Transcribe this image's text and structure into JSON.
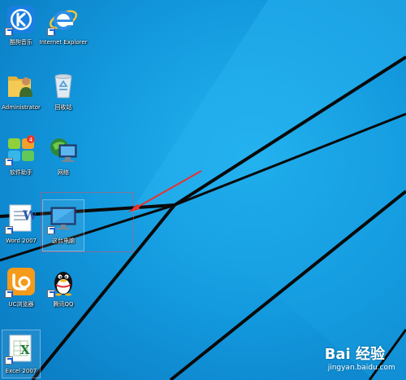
{
  "desktop": {
    "background_color": "#1196dd",
    "line_color": "#0b0b0b",
    "icons": [
      {
        "label": "酷狗音乐",
        "icon": "kugou-k-icon"
      },
      {
        "label": "Internet Explorer",
        "icon": "internet-explorer-icon"
      },
      {
        "label": "Administrator",
        "icon": "user-folder-icon"
      },
      {
        "label": "回收站",
        "icon": "recycle-bin-icon"
      },
      {
        "label": "软件助手",
        "icon": "software-assistant-icon",
        "badge": "4"
      },
      {
        "label": "网络",
        "icon": "network-globe-icon"
      },
      {
        "label": "Word 2007",
        "icon": "word-document-icon"
      },
      {
        "label": "这台电脑",
        "icon": "this-pc-icon"
      },
      {
        "label": "UC浏览器",
        "icon": "uc-browser-icon"
      },
      {
        "label": "腾讯QQ",
        "icon": "qq-penguin-icon"
      },
      {
        "label": "Excel 2007",
        "icon": "excel-spreadsheet-icon"
      }
    ]
  },
  "watermark": {
    "brand": "Bai 经验",
    "url": "jingyan.baidu.com"
  }
}
